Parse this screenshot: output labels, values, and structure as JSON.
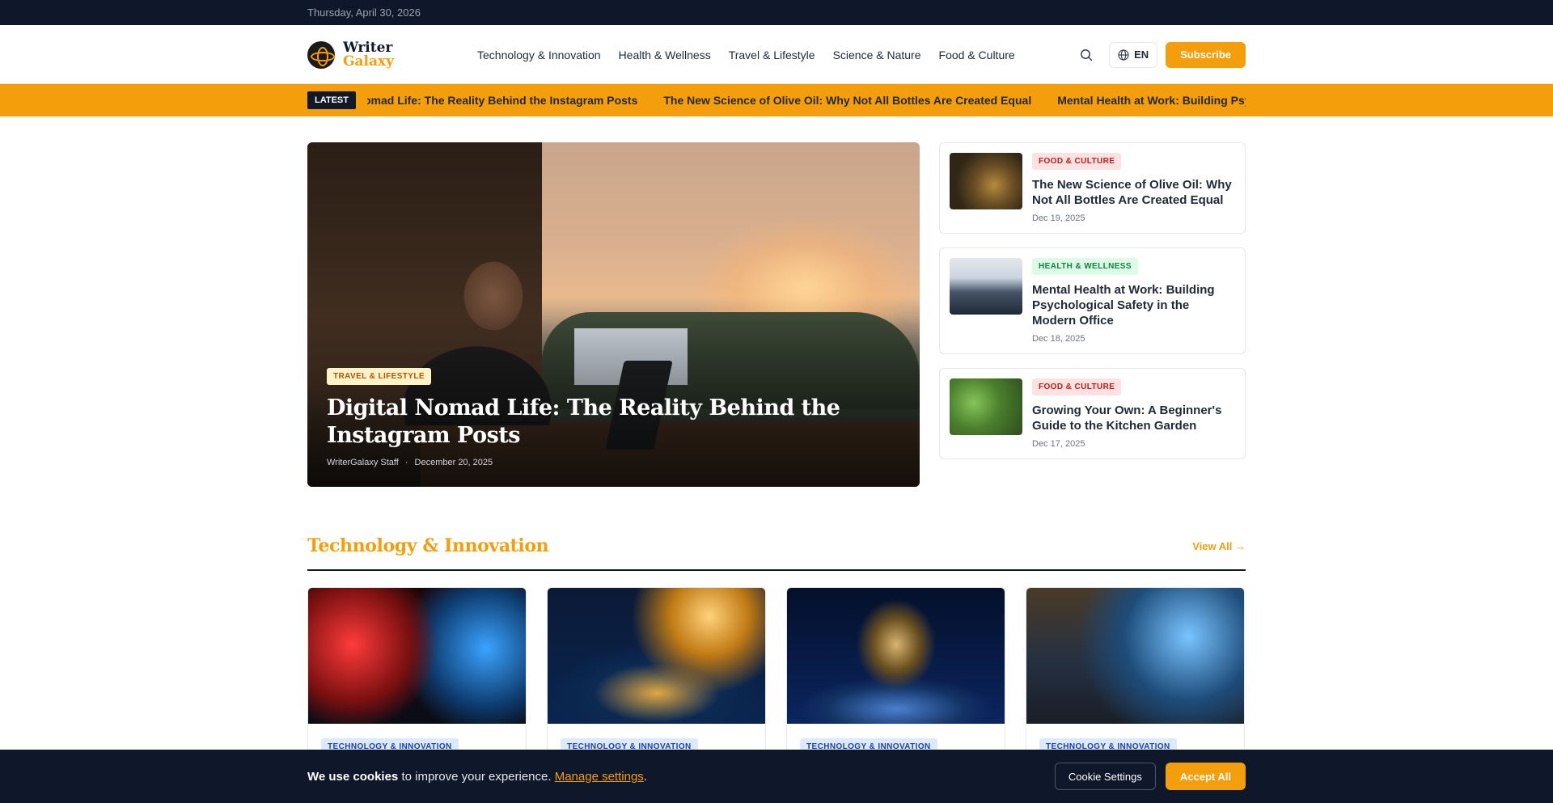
{
  "topbar": {
    "date": "Thursday, April 30, 2026"
  },
  "brand": {
    "line1": "Writer",
    "line2": "Galaxy"
  },
  "nav": [
    {
      "label": "Technology & Innovation"
    },
    {
      "label": "Health & Wellness"
    },
    {
      "label": "Travel & Lifestyle"
    },
    {
      "label": "Science & Nature"
    },
    {
      "label": "Food & Culture"
    }
  ],
  "header": {
    "lang": "EN",
    "subscribe": "Subscribe",
    "search_icon": "search-icon",
    "lang_icon": "globe-icon"
  },
  "ticker": {
    "badge": "LATEST",
    "items": [
      "omad Life: The Reality Behind the Instagram Posts",
      "The New Science of Olive Oil: Why Not All Bottles Are Created Equal",
      "Mental Health at Work: Building Psychological"
    ]
  },
  "hero": {
    "category": "TRAVEL & LIFESTYLE",
    "title": "Digital Nomad Life: The Reality Behind the Instagram Posts",
    "author": "WriterGalaxy Staff",
    "separator": "·",
    "date": "December 20, 2025"
  },
  "side_articles": [
    {
      "category": "FOOD & CULTURE",
      "title": "The New Science of Olive Oil: Why Not All Bottles Are Created Equal",
      "date": "Dec 19, 2025"
    },
    {
      "category": "HEALTH & WELLNESS",
      "title": "Mental Health at Work: Building Psychological Safety in the Modern Office",
      "date": "Dec 18, 2025"
    },
    {
      "category": "FOOD & CULTURE",
      "title": "Growing Your Own: A Beginner's Guide to the Kitchen Garden",
      "date": "Dec 17, 2025"
    }
  ],
  "section": {
    "title": "Technology & Innovation",
    "view_all": "View All →"
  },
  "tech_cards": [
    {
      "category": "TECHNOLOGY & INNOVATION"
    },
    {
      "category": "TECHNOLOGY & INNOVATION"
    },
    {
      "category": "TECHNOLOGY & INNOVATION"
    },
    {
      "category": "TECHNOLOGY & INNOVATION"
    }
  ],
  "cookie": {
    "bold": "We use cookies",
    "text": " to improve your experience. ",
    "link": "Manage settings",
    "end": ".",
    "settings_button": "Cookie Settings",
    "accept_button": "Accept All"
  },
  "colors": {
    "accent": "#f59e0b",
    "dark": "#0f172a"
  }
}
